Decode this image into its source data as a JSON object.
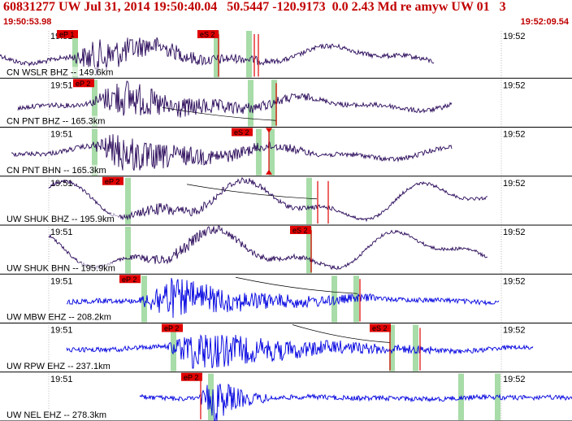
{
  "header": {
    "title": "60831277 UW Jul 31, 2014 19:50:40.04   50.5447 -120.9173  0.0 2.43 Md re amyw UW 01   3",
    "start_time": "19:50:53.98",
    "end_time": "19:52:09.54"
  },
  "colors": {
    "title": "#c00000",
    "pick_box": "#e00000",
    "window_marker": "#a8dca8",
    "trace_dark": "#2a0a5a",
    "trace_blue": "#0000e0",
    "grid": "#000000"
  },
  "traces": [
    {
      "label": "CN WSLR BHZ -- 149.6km",
      "t_left": "19:51",
      "t_right": "19:52",
      "color": "dark",
      "picks": [
        {
          "text": "eP 1",
          "t": 0.0
        },
        {
          "text": "eS 2",
          "t": 0.52
        }
      ]
    },
    {
      "label": "CN PNT BHZ -- 165.3km",
      "t_left": "19:51",
      "t_right": "19:52",
      "color": "dark",
      "picks": [
        {
          "text": "eP 2",
          "t": 0.0
        }
      ]
    },
    {
      "label": "CN PNT BHN -- 165.3km",
      "t_left": "19:51",
      "t_right": "19:52",
      "color": "dark",
      "picks": [
        {
          "text": "eS 2",
          "t": 0.0
        }
      ]
    },
    {
      "label": "UW SHUK BHZ -- 195.9km",
      "t_left": "19:51",
      "t_right": "19:52",
      "color": "dark",
      "picks": [
        {
          "text": "eP 2",
          "t": 0.0
        }
      ]
    },
    {
      "label": "UW SHUK BHN -- 195.9km",
      "t_left": "19:51",
      "t_right": "19:52",
      "color": "dark",
      "picks": [
        {
          "text": "eS 2",
          "t": 0.0
        }
      ]
    },
    {
      "label": "UW MBW EHZ -- 208.2km",
      "t_left": "19:51",
      "t_right": "19:52",
      "color": "blue",
      "picks": [
        {
          "text": "eP 2",
          "t": 0.0
        }
      ]
    },
    {
      "label": "UW RPW EHZ -- 237.1km",
      "t_left": "19:51",
      "t_right": "19:52",
      "color": "blue",
      "picks": [
        {
          "text": "eP 2",
          "t": 0.0
        },
        {
          "text": "eS 2",
          "t": 0.0
        }
      ]
    },
    {
      "label": "UW NEL EHZ -- 278.3km",
      "t_left": "19:51",
      "t_right": "19:52",
      "color": "blue",
      "picks": [
        {
          "text": "eP 2",
          "t": 0.0
        }
      ]
    }
  ]
}
